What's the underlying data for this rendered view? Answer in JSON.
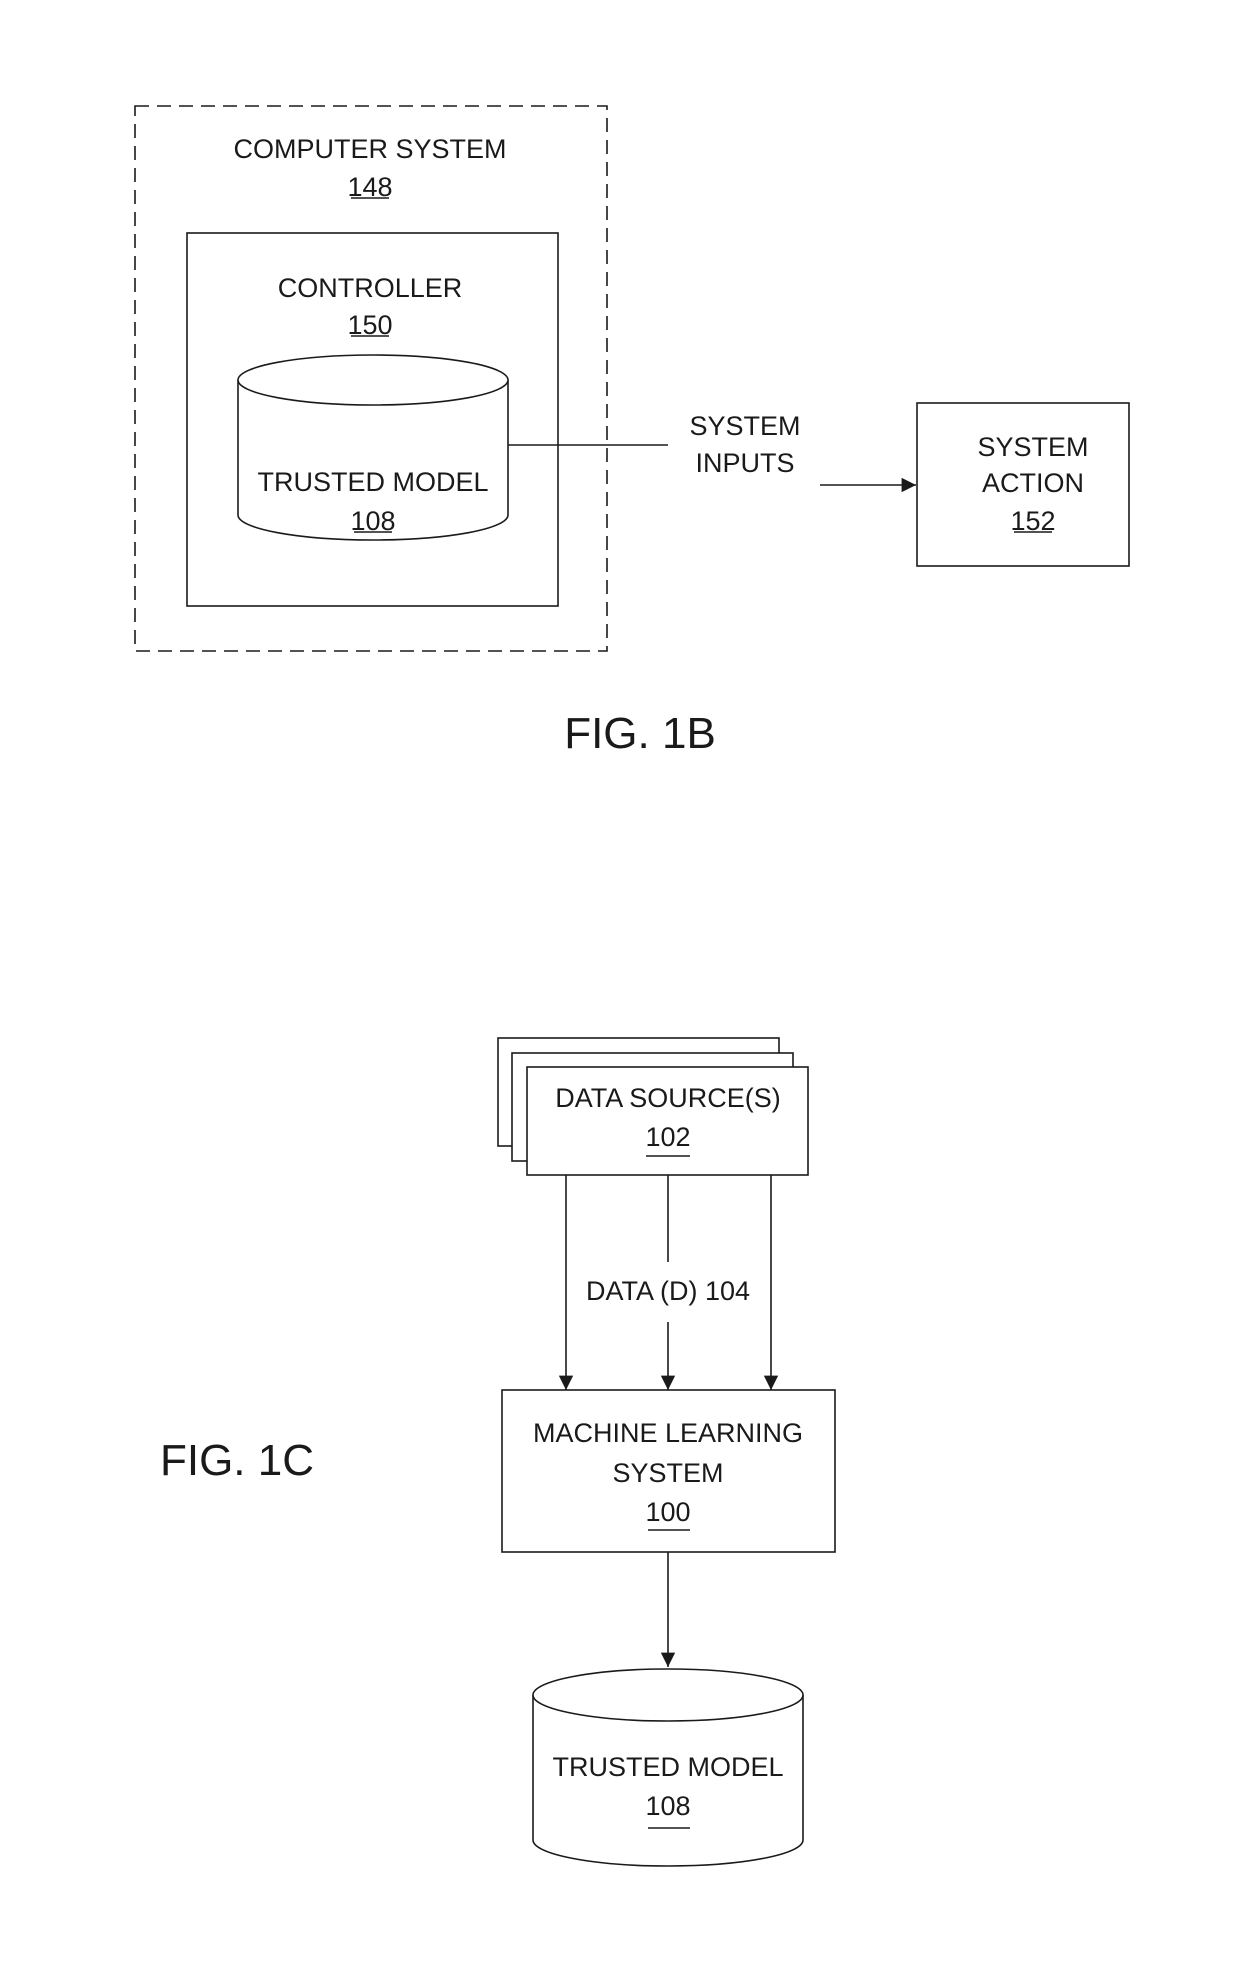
{
  "fig_1b": {
    "caption": "FIG. 1B",
    "computer_system": {
      "label": "COMPUTER SYSTEM",
      "ref": "148"
    },
    "controller": {
      "label": "CONTROLLER",
      "ref": "150"
    },
    "trusted_model": {
      "label": "TRUSTED MODEL",
      "ref": "108"
    },
    "connector": {
      "label_line1": "SYSTEM",
      "label_line2": "INPUTS"
    },
    "system_action": {
      "label_line1": "SYSTEM",
      "label_line2": "ACTION",
      "ref": "152"
    }
  },
  "fig_1c": {
    "caption": "FIG. 1C",
    "data_sources": {
      "label": "DATA SOURCE(S)",
      "ref": "102"
    },
    "data_flow": {
      "label": "DATA (D)  104"
    },
    "ml_system": {
      "label_line1": "MACHINE LEARNING",
      "label_line2": "SYSTEM",
      "ref": "100"
    },
    "trusted_model": {
      "label": "TRUSTED MODEL",
      "ref": "108"
    }
  }
}
